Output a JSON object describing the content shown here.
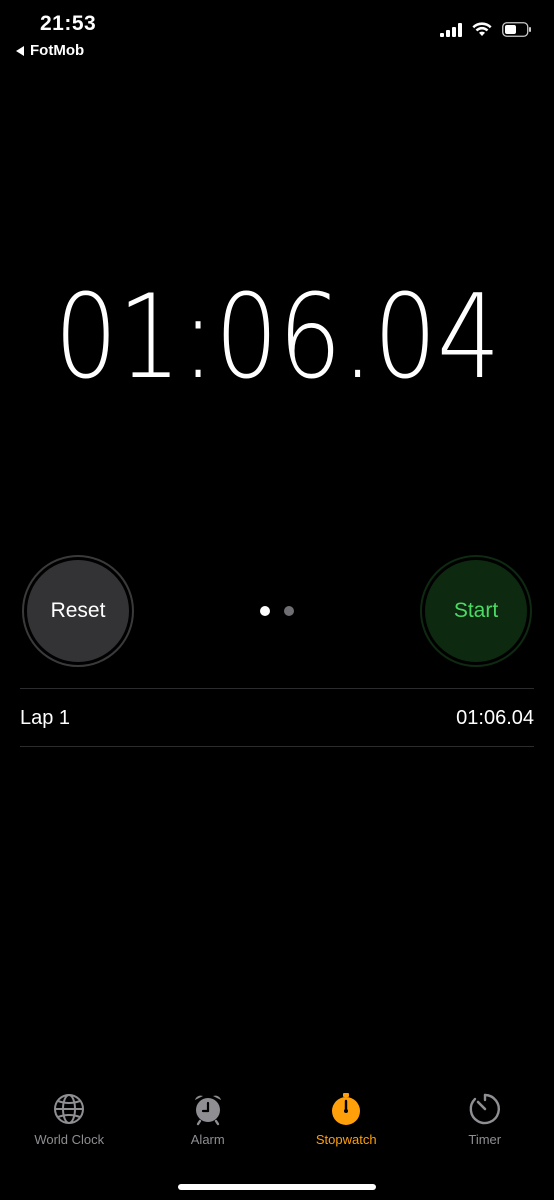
{
  "status_bar": {
    "time": "21:53",
    "back_app": "FotMob"
  },
  "stopwatch": {
    "display": "01:06.04",
    "reset_label": "Reset",
    "start_label": "Start"
  },
  "laps": [
    {
      "label": "Lap 1",
      "time": "01:06.04"
    }
  ],
  "tabs": [
    {
      "label": "World Clock",
      "icon": "globe-icon",
      "active": false
    },
    {
      "label": "Alarm",
      "icon": "alarm-clock-icon",
      "active": false
    },
    {
      "label": "Stopwatch",
      "icon": "stopwatch-icon",
      "active": true
    },
    {
      "label": "Timer",
      "icon": "timer-icon",
      "active": false
    }
  ],
  "colors": {
    "accent": "#ff9f0a",
    "start_green": "#4cd964",
    "inactive": "#8e8e93"
  }
}
